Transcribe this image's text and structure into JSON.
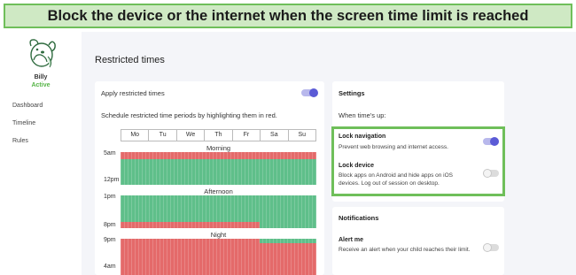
{
  "banner": {
    "text": "Block the device or the internet when the screen time limit is reached"
  },
  "profile": {
    "name": "Billy",
    "status": "Active",
    "icon": "dog-mascot-icon"
  },
  "nav": {
    "items": [
      "Dashboard",
      "Timeline",
      "Rules"
    ]
  },
  "main": {
    "title": "Restricted times"
  },
  "apply": {
    "label": "Apply restricted times",
    "enabled": true
  },
  "schedule": {
    "instruction": "Schedule restricted time periods by highlighting them in red.",
    "days": [
      "Mo",
      "Tu",
      "We",
      "Th",
      "Fr",
      "Sa",
      "Su"
    ],
    "sections": {
      "morning": "Morning",
      "afternoon": "Afternoon",
      "night": "Night"
    },
    "times": {
      "t5am": "5am",
      "t12pm": "12pm",
      "t1pm": "1pm",
      "t8pm": "8pm",
      "t9pm": "9pm",
      "t4am": "4am"
    }
  },
  "settings": {
    "heading": "Settings",
    "when": "When time's up:",
    "lock_navigation": {
      "title": "Lock navigation",
      "desc": "Prevent web browsing and internet access.",
      "enabled": true
    },
    "lock_device": {
      "title": "Lock device",
      "desc": "Block apps on Android and hide apps on iOS devices. Log out of session on desktop.",
      "enabled": false
    }
  },
  "notifications": {
    "heading": "Notifications",
    "alert": {
      "title": "Alert me",
      "desc": "Receive an alert when your child reaches their limit.",
      "enabled": false
    }
  },
  "colors": {
    "accent": "#5b5bd6",
    "restricted": "#e46a6a",
    "allowed": "#5fbf8a",
    "highlight": "#6fbf5a",
    "banner_bg": "#cfe9c4"
  }
}
